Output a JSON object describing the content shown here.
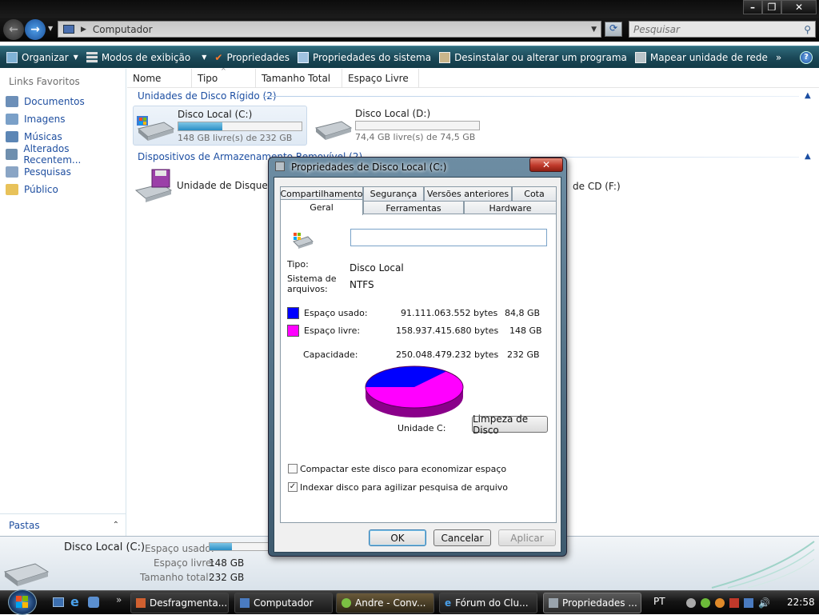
{
  "address": {
    "path": "Computador",
    "search_placeholder": "Pesquisar"
  },
  "toolbar": {
    "organize": "Organizar",
    "views": "Modos de exibição",
    "properties": "Propriedades",
    "system_properties": "Propriedades do sistema",
    "uninstall": "Desinstalar ou alterar um programa",
    "map_drive": "Mapear unidade de rede",
    "more": "»"
  },
  "sidebar": {
    "heading": "Links Favoritos",
    "items": [
      {
        "label": "Documentos",
        "icon": "documents-icon"
      },
      {
        "label": "Imagens",
        "icon": "pictures-icon"
      },
      {
        "label": "Músicas",
        "icon": "music-icon"
      },
      {
        "label": "Alterados Recentem...",
        "icon": "recent-icon"
      },
      {
        "label": "Pesquisas",
        "icon": "searches-icon"
      },
      {
        "label": "Público",
        "icon": "public-folder-icon"
      }
    ],
    "folders": "Pastas"
  },
  "columns": [
    "Nome",
    "Tipo",
    "Tamanho Total",
    "Espaço Livre"
  ],
  "groups": {
    "hard_disks": "Unidades de Disco Rígido (2)",
    "removable": "Dispositivos de Armazenamento Removível (2)"
  },
  "drives": [
    {
      "name": "Disco Local (C:)",
      "free_text": "148 GB livre(s) de 232 GB",
      "used_fraction": 0.36
    },
    {
      "name": "Disco Local (D:)",
      "free_text": "74,4 GB livre(s) de 74,5 GB",
      "used_fraction": 0.0
    }
  ],
  "removable_items": {
    "floppy": "Unidade de Disquete",
    "cd": "de CD (F:)"
  },
  "details": {
    "name": "Disco Local (C:)",
    "used_label": "Espaço usado:",
    "free_label": "Espaço livre:",
    "free_value": "148 GB",
    "total_label": "Tamanho total:",
    "total_value": "232 GB",
    "used_fraction": 0.36
  },
  "taskbar": {
    "tasks": [
      "Desfragmenta...",
      "Computador",
      "Andre - Conv...",
      "Fórum do Clu...",
      "Propriedades ..."
    ],
    "language": "PT",
    "time": "22:58"
  },
  "dialog": {
    "title": "Propriedades de Disco Local (C:)",
    "tabs_row1": [
      "Compartilhamento",
      "Segurança",
      "Versões anteriores",
      "Cota"
    ],
    "tabs_row2": [
      "Geral",
      "Ferramentas",
      "Hardware"
    ],
    "label_value": "",
    "type_label": "Tipo:",
    "type_value": "Disco Local",
    "fs_label": "Sistema de arquivos:",
    "fs_value": "NTFS",
    "used_label": "Espaço usado:",
    "used_bytes": "91.111.063.552 bytes",
    "used_size": "84,8 GB",
    "free_label": "Espaço livre:",
    "free_bytes": "158.937.415.680 bytes",
    "free_size": "148 GB",
    "capacity_label": "Capacidade:",
    "capacity_bytes": "250.048.479.232 bytes",
    "capacity_size": "232 GB",
    "drive_label": "Unidade C:",
    "cleanup_button": "Limpeza de Disco",
    "compress_label": "Compactar este disco para economizar espaço",
    "compress_checked": false,
    "index_label": "Indexar disco para agilizar pesquisa de arquivo",
    "index_checked": true,
    "ok": "OK",
    "cancel": "Cancelar",
    "apply": "Aplicar",
    "used_color": "#0000ff",
    "free_color": "#ff00ff",
    "used_fraction": 0.364
  }
}
